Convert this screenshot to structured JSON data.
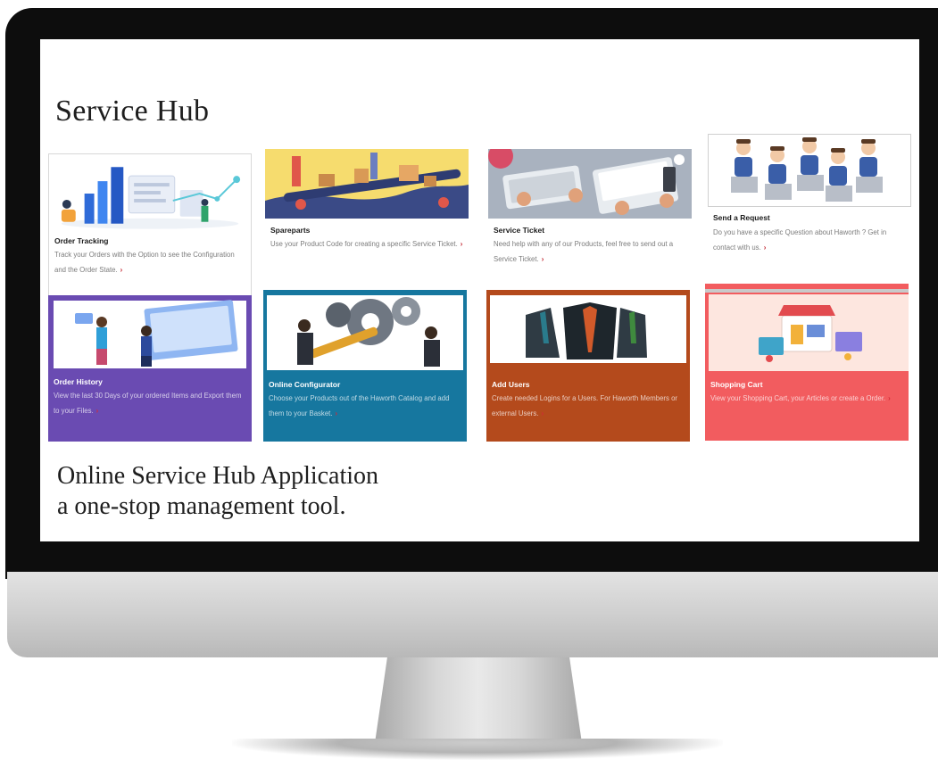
{
  "hub": {
    "title": "Service Hub",
    "tagline_line1": "Online Service Hub Application",
    "tagline_line2": "a one-stop management tool."
  },
  "cards": [
    {
      "title": "Order Tracking",
      "description": "Track your Orders with the Option to see the Configuration and the Order State.",
      "arrow": "›",
      "color": "#ffffff"
    },
    {
      "title": "Spareparts",
      "description": "Use your Product Code for creating a specific Service Ticket.",
      "arrow": "›",
      "color": "#ffffff"
    },
    {
      "title": "Service Ticket",
      "description": "Need help with any of our Products, feel free to send out a Service Ticket.",
      "arrow": "›",
      "color": "#ffffff"
    },
    {
      "title": "Send a Request",
      "description": "Do you have a specific Question about Haworth ? Get in contact with us.",
      "arrow": "›",
      "color": "#ffffff"
    },
    {
      "title": "Order History",
      "description": "View the last 30 Days of your ordered Items and Export them to your Files.",
      "arrow": "›",
      "color": "#6a4bb2"
    },
    {
      "title": "Online Configurator",
      "description": "Choose your Products out of the Haworth Catalog and add them to your Basket.",
      "arrow": "›",
      "color": "#16779f"
    },
    {
      "title": "Add Users",
      "description": "Create needed Logins for a Users. For Haworth Members or external Users.",
      "arrow": "›",
      "color": "#b44a1c"
    },
    {
      "title": "Shopping Cart",
      "description": "View your Shopping Cart, your Articles or create a Order.",
      "arrow": "›",
      "color": "#f25c5f"
    }
  ]
}
